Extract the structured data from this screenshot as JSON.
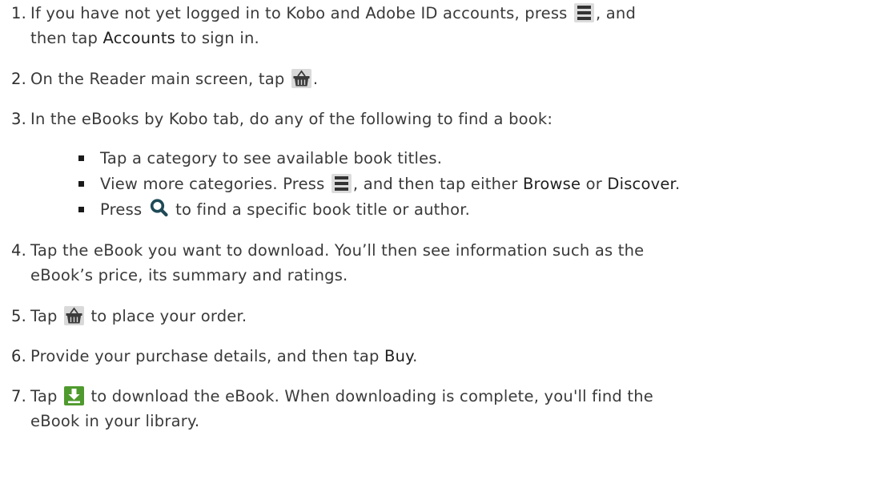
{
  "steps": [
    {
      "number": "1.",
      "line1_pre": "If you have not yet logged in to Kobo and Adobe ID accounts, press",
      "line1_post": ", and",
      "line2_pre": "then tap",
      "accounts_label": "Accounts",
      "line2_post": "to sign in.",
      "icon": "menu-icon"
    },
    {
      "number": "2.",
      "pre": "On the Reader main screen, tap",
      "post": ".",
      "icon": "store-basket-icon"
    },
    {
      "number": "3.",
      "text": "In the eBooks by Kobo tab, do any of the following to find a book:",
      "bullets": {
        "b1": "Tap a category to see available book titles.",
        "b2_pre": "View more categories. Press",
        "b2_mid": ", and then tap either",
        "browse_label": "Browse",
        "b2_or": "or",
        "discover_label": "Discover",
        "b2_end": ".",
        "b3_pre": "Press",
        "b3_post": "to find a specific book title or author.",
        "b2_icon": "menu-icon",
        "b3_icon": "search-icon"
      }
    },
    {
      "number": "4.",
      "line1": "Tap the eBook you want to download. You’ll then see information such as the",
      "line2": "eBook’s price, its summary and ratings."
    },
    {
      "number": "5.",
      "pre": "Tap",
      "post": "to place your order.",
      "icon": "store-basket-icon"
    },
    {
      "number": "6.",
      "pre": "Provide your purchase details, and then tap",
      "buy_label": "Buy",
      "post": "."
    },
    {
      "number": "7.",
      "pre": "Tap",
      "post": "to download the eBook. When downloading is complete, you'll find the",
      "line2": "eBook in your library.",
      "icon": "download-icon"
    }
  ],
  "colors": {
    "text": "#3a3a3a",
    "icon_dark": "#3b3b3b",
    "icon_bg": "#dcdcdc",
    "download_green": "#4f9a2e",
    "search_teal": "#1f4a57"
  }
}
